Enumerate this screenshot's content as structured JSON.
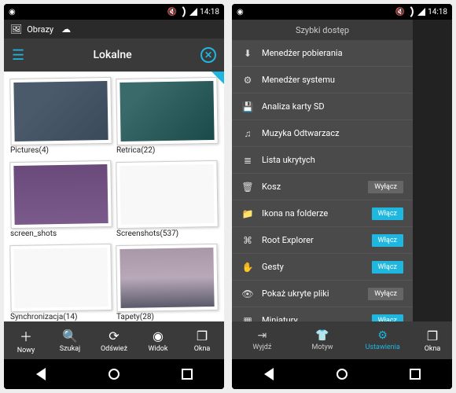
{
  "statusbar": {
    "time": "14:18"
  },
  "notif": {
    "label": "Obrazy"
  },
  "screen1": {
    "header_title": "Lokalne",
    "folders": [
      {
        "name": "Pictures",
        "count": 4
      },
      {
        "name": "Retrica",
        "count": 22
      },
      {
        "name": "screen_shots",
        "count": ""
      },
      {
        "name": "Screenshots",
        "count": 537
      },
      {
        "name": "Synchronizacja",
        "count": 14
      },
      {
        "name": "Tapety",
        "count": 28
      }
    ],
    "bottom": [
      {
        "icon": "+",
        "label": "Nowy"
      },
      {
        "icon": "search",
        "label": "Szukaj"
      },
      {
        "icon": "refresh",
        "label": "Odśwież"
      },
      {
        "icon": "view",
        "label": "Widok"
      },
      {
        "icon": "windows",
        "label": "Okna"
      }
    ]
  },
  "screen2": {
    "drawer_title": "Szybki dostęp",
    "items": [
      {
        "icon": "download",
        "label": "Menedżer pobierania",
        "toggle": null
      },
      {
        "icon": "system",
        "label": "Menedżer systemu",
        "toggle": null
      },
      {
        "icon": "sd",
        "label": "Analiza karty SD",
        "toggle": null
      },
      {
        "icon": "music",
        "label": "Muzyka Odtwarzacz",
        "toggle": null
      },
      {
        "icon": "list",
        "label": "Lista ukrytych",
        "toggle": null
      },
      {
        "icon": "trash",
        "label": "Kosz",
        "toggle": "Wyłącz"
      },
      {
        "icon": "folder",
        "label": "Ikona na folderze",
        "toggle": "Włącz"
      },
      {
        "icon": "root",
        "label": "Root Explorer",
        "toggle": "Włącz"
      },
      {
        "icon": "gesture",
        "label": "Gesty",
        "toggle": "Włącz"
      },
      {
        "icon": "hidden",
        "label": "Pokaż ukryte pliki",
        "toggle": "Wyłącz"
      },
      {
        "icon": "thumb",
        "label": "Miniatury",
        "toggle": "Włącz"
      }
    ],
    "bottom": [
      {
        "icon": "exit",
        "label": "Wyjdź"
      },
      {
        "icon": "theme",
        "label": "Motyw"
      },
      {
        "icon": "settings",
        "label": "Ustawienia"
      }
    ],
    "side_item": {
      "icon": "windows",
      "label": "Okna"
    }
  },
  "toggle_labels": {
    "on": "Włącz",
    "off": "Wyłącz"
  }
}
